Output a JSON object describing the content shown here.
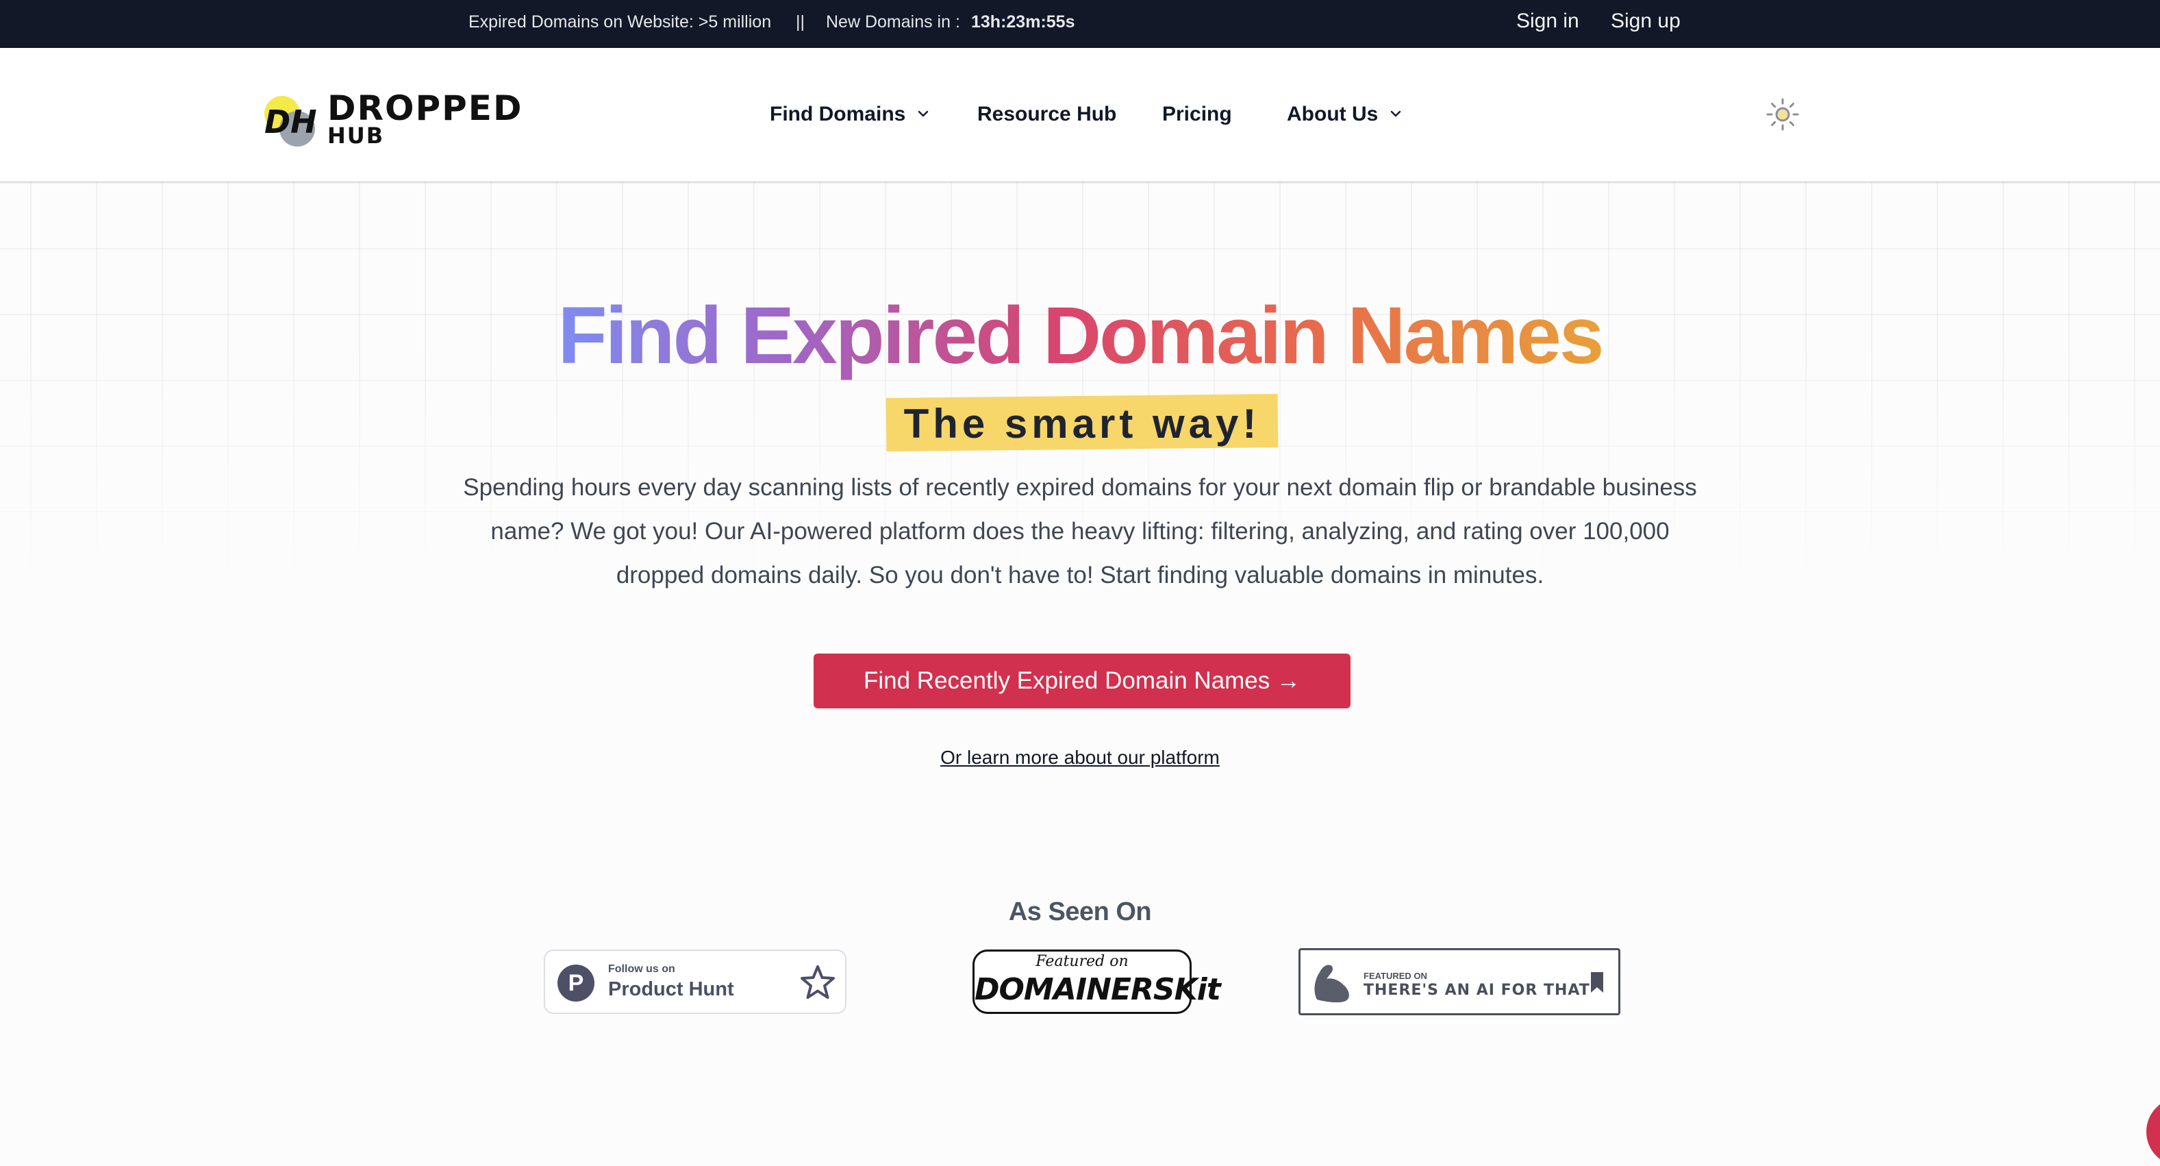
{
  "topbar": {
    "expired_stat": "Expired Domains on Website: >5 million",
    "separator": "||",
    "new_domains_label": "New Domains in :",
    "countdown": "13h:23m:55s",
    "signin": "Sign in",
    "signup": "Sign up"
  },
  "logo": {
    "mark": "DH",
    "line1": "DROPPED",
    "line2": "HUB"
  },
  "nav": {
    "find_domains": "Find Domains",
    "resource_hub": "Resource Hub",
    "pricing": "Pricing",
    "about_us": "About Us"
  },
  "icons": {
    "theme": "sun-icon",
    "dropdown": "chevron-down-icon",
    "star": "star-icon",
    "bookmark": "bookmark-icon"
  },
  "hero": {
    "title": "Find Expired Domain Names",
    "tagline": "The smart way!",
    "description": "Spending hours every day scanning lists of recently expired domains for your next domain flip or brandable business name? We got you! Our AI-powered platform does the heavy lifting: filtering, analyzing, and rating over 100,000 dropped domains daily. So you don't have to! Start finding valuable domains in minutes.",
    "cta": "Find Recently Expired Domain Names →",
    "learn_more": "Or learn more about our platform"
  },
  "seen_on": {
    "title": "As Seen On",
    "product_hunt": {
      "small": "Follow us on",
      "big": "Product Hunt",
      "initial": "P"
    },
    "domainerskit": {
      "small": "Featured on",
      "big": "DOMAINERSKit"
    },
    "ai_for_that": {
      "small": "FEATURED ON",
      "big": "THERE'S AN AI FOR THAT"
    }
  },
  "colors": {
    "topbar_bg": "#121828",
    "cta_bg": "#d1304e",
    "highlight": "#f7d66a",
    "gradient_start": "#7f8cf0",
    "gradient_mid": "#d8456f",
    "gradient_end": "#e8a03a"
  }
}
